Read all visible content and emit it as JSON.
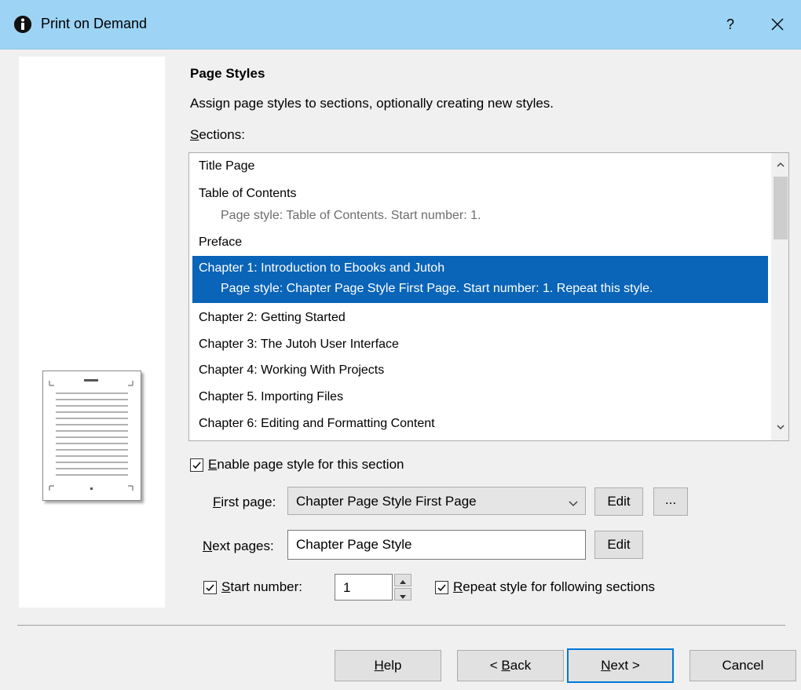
{
  "window": {
    "title": "Print on Demand",
    "help_label": "?",
    "colors": {
      "titlebar": "#9dd3f4",
      "selection": "#0a64b8",
      "accent_border": "#0078d7"
    }
  },
  "content": {
    "heading": "Page Styles",
    "description": "Assign page styles to sections, optionally creating new styles.",
    "sections_label": {
      "underlined": "S",
      "rest": "ections:"
    }
  },
  "sections": {
    "items": [
      {
        "label": "Title Page",
        "detail": ""
      },
      {
        "label": "Table of Contents",
        "detail": "Page style: Table of Contents. Start number: 1."
      },
      {
        "label": "Preface",
        "detail": ""
      },
      {
        "label": "Chapter 1: Introduction to Ebooks and Jutoh",
        "detail": "Page style: Chapter Page Style First Page. Start number: 1. Repeat this style.",
        "selected": true
      },
      {
        "label": "Chapter 2: Getting Started",
        "detail": ""
      },
      {
        "label": "Chapter 3: The Jutoh User Interface",
        "detail": ""
      },
      {
        "label": "Chapter 4: Working With Projects",
        "detail": ""
      },
      {
        "label": "Chapter 5. Importing Files",
        "detail": ""
      },
      {
        "label": "Chapter 6: Editing and Formatting Content",
        "detail": ""
      }
    ]
  },
  "options": {
    "enable_style": {
      "underlined": "E",
      "rest": "nable page style for this section",
      "checked": true
    },
    "first_page": {
      "label_underlined": "F",
      "label_rest": "irst page:",
      "value": "Chapter Page Style First Page",
      "edit_label": "Edit",
      "more_label": "..."
    },
    "next_pages": {
      "label_underlined": "N",
      "label_rest": "ext pages:",
      "value": "Chapter Page Style",
      "edit_label": "Edit"
    },
    "start_number": {
      "underlined": "S",
      "rest": "tart number:",
      "checked": true,
      "value": "1"
    },
    "repeat_style": {
      "underlined": "R",
      "rest": "epeat style for following sections",
      "checked": true
    }
  },
  "footer": {
    "help": {
      "underlined": "H",
      "rest": "elp"
    },
    "back": {
      "prefix": "< ",
      "underlined": "B",
      "rest": "ack"
    },
    "next": {
      "underlined": "N",
      "rest": "ext >"
    },
    "cancel": "Cancel"
  }
}
